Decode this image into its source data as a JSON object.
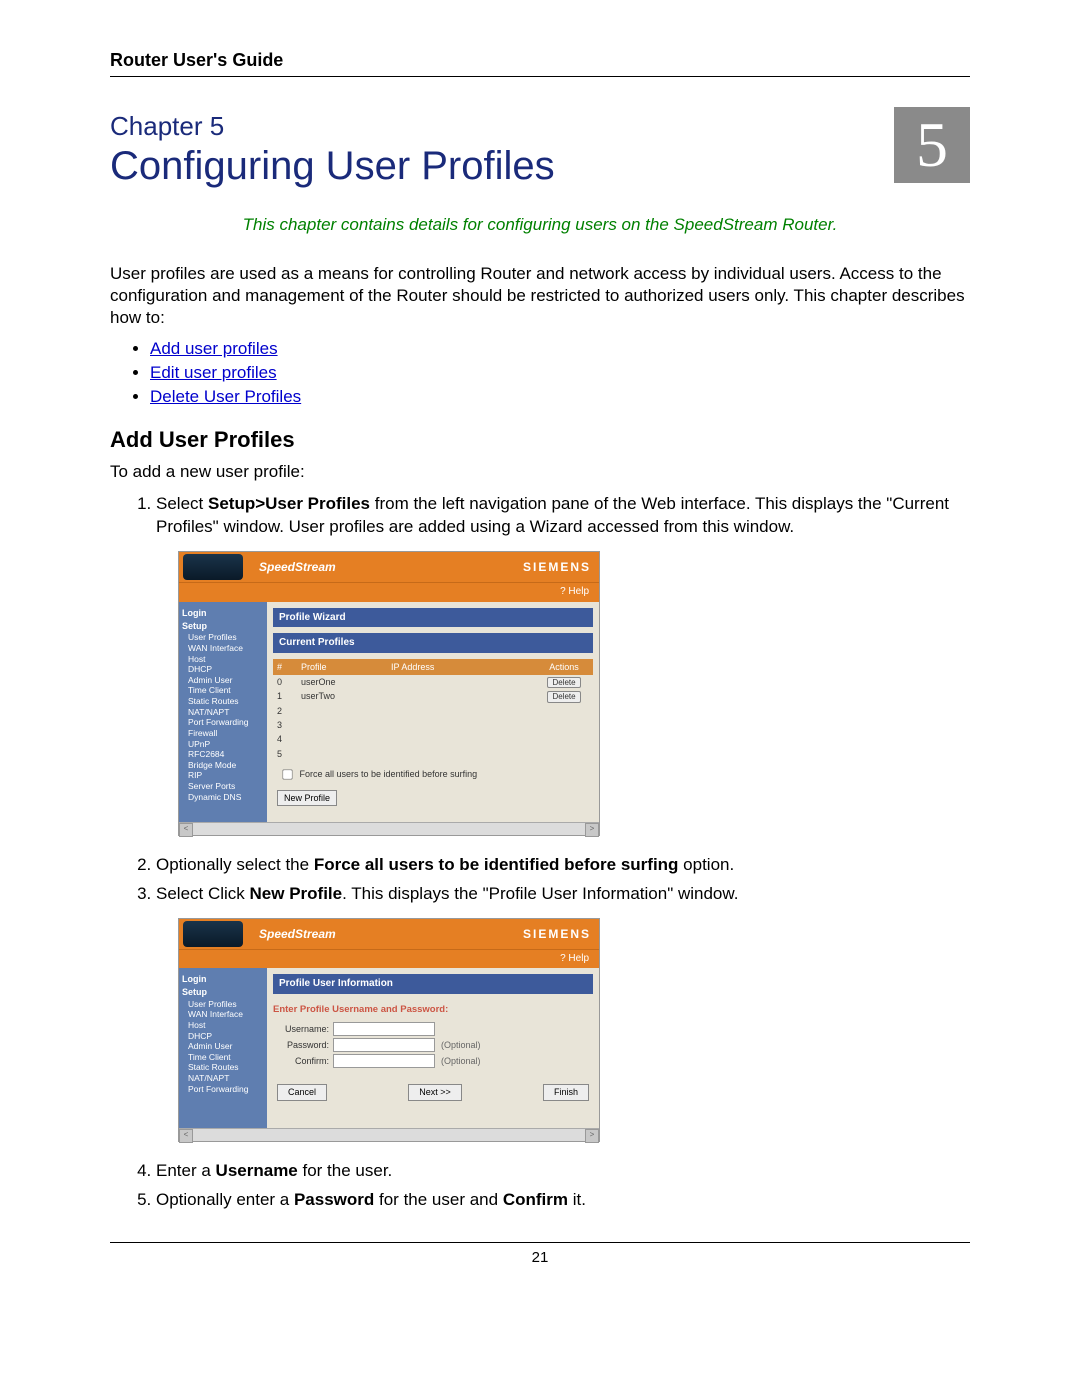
{
  "header": {
    "title": "Router User's Guide"
  },
  "chapter": {
    "label": "Chapter 5",
    "number": "5",
    "heading": "Configuring User Profiles",
    "caption": "This chapter contains details for configuring users on the SpeedStream Router."
  },
  "intro": "User profiles are used as a means for controlling Router and network access by individual users. Access to the configuration and management of the Router should be restricted to authorized users only. This chapter describes how to:",
  "toc": [
    "Add user profiles",
    "Edit user profiles",
    "Delete User Profiles"
  ],
  "section": {
    "title": "Add User Profiles",
    "lead": "To add a new user profile:",
    "steps": {
      "s1_pre": "Select ",
      "s1_bold": "Setup>User Profiles",
      "s1_post": " from the left navigation pane of the Web interface. This displays the \"Current Profiles\" window. User profiles are added using a Wizard accessed from this window.",
      "s2_pre": "Optionally select the ",
      "s2_bold": "Force all users to be identified before surfing",
      "s2_post": " option.",
      "s3_pre": "Select Click ",
      "s3_bold": "New Profile",
      "s3_post": ". This displays the \"Profile User Information\" window.",
      "s4_pre": "Enter a ",
      "s4_bold": "Username",
      "s4_post": " for the user.",
      "s5_pre": "Optionally enter a ",
      "s5_bold1": "Password",
      "s5_mid": " for the user and ",
      "s5_bold2": "Confirm",
      "s5_post": " it."
    }
  },
  "shot_common": {
    "brand": "SpeedStream",
    "siemens": "SIEMENS",
    "help": "? Help",
    "nav": {
      "login": "Login",
      "setup": "Setup",
      "items": [
        "User Profiles",
        "WAN Interface",
        "Host",
        "DHCP",
        "Admin User",
        "Time Client",
        "Static Routes",
        "NAT/NAPT",
        "Port Forwarding",
        "Firewall",
        "UPnP",
        "RFC2684",
        "Bridge Mode",
        "RIP",
        "Server Ports",
        "Dynamic DNS"
      ]
    }
  },
  "shot1": {
    "bar1": "Profile Wizard",
    "bar2": "Current Profiles",
    "cols": [
      "#",
      "Profile",
      "IP Address",
      "Actions"
    ],
    "rows": [
      {
        "n": "0",
        "p": "userOne",
        "a": "Delete"
      },
      {
        "n": "1",
        "p": "userTwo",
        "a": "Delete"
      },
      {
        "n": "2",
        "p": "",
        "a": ""
      },
      {
        "n": "3",
        "p": "",
        "a": ""
      },
      {
        "n": "4",
        "p": "",
        "a": ""
      },
      {
        "n": "5",
        "p": "",
        "a": ""
      }
    ],
    "force": "Force all users to be identified before surfing",
    "new_btn": "New Profile"
  },
  "shot2": {
    "bar": "Profile User Information",
    "enter_pre": "Enter Profile ",
    "enter_hl": "Username and Password",
    "enter_post": ":",
    "username": "Username:",
    "password": "Password:",
    "confirm": "Confirm:",
    "optional": "(Optional)",
    "cancel": "Cancel",
    "next": "Next >>",
    "finish": "Finish"
  },
  "footer": {
    "page": "21"
  }
}
